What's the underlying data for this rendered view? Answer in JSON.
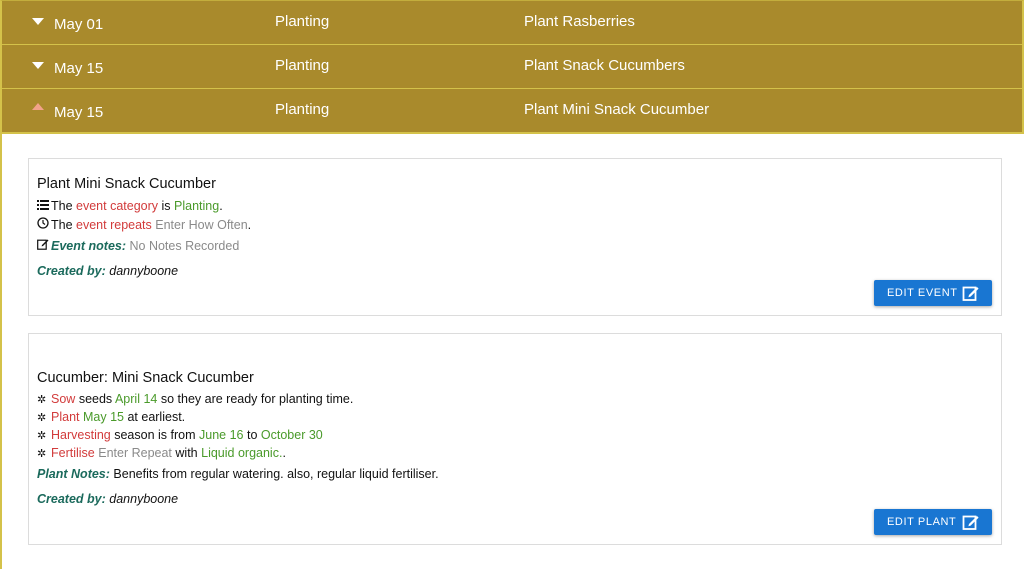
{
  "rows": [
    {
      "date": "May 01",
      "category": "Planting",
      "title": "Plant Rasberries"
    },
    {
      "date": "May 15",
      "category": "Planting",
      "title": "Plant Snack Cucumbers"
    },
    {
      "date": "May 15",
      "category": "Planting",
      "title": "Plant Mini Snack Cucumber"
    }
  ],
  "event_card": {
    "title": "Plant Mini Snack Cucumber",
    "line1": {
      "prefix": "The",
      "key": "event category",
      "mid": "is",
      "value": "Planting",
      "suffix": "."
    },
    "line2": {
      "prefix": "The",
      "key": "event repeats",
      "value": "Enter How Often",
      "suffix": "."
    },
    "notes_label": "Event notes:",
    "notes_value": "No Notes Recorded",
    "created_label": "Created by:",
    "created_value": "dannyboone",
    "button_label": "EDIT EVENT"
  },
  "plant_card": {
    "title": "Cucumber: Mini Snack Cucumber",
    "sow": {
      "key": "Sow",
      "a": "seeds",
      "date": "April 14",
      "b": "so they are ready for planting time."
    },
    "plant": {
      "key": "Plant",
      "date": "May 15",
      "b": "at earliest."
    },
    "harvest": {
      "key": "Harvesting",
      "a": "season is from",
      "from": "June 16",
      "to_word": "to",
      "to": "October 30"
    },
    "fertilise": {
      "key": "Fertilise",
      "repeat": "Enter Repeat",
      "with_word": "with",
      "value": "Liquid organic.",
      "suffix": "."
    },
    "notes_label": "Plant Notes:",
    "notes_value": "Benefits from regular watering. also, regular liquid fertiliser.",
    "created_label": "Created by:",
    "created_value": "dannyboone",
    "button_label": "EDIT PLANT"
  },
  "colors": {
    "header_bg": "#a98a2c",
    "accent_button": "#1976d2",
    "key_red": "#d23b3b",
    "value_green": "#4a9a2a",
    "label_teal": "#1b6a5c"
  }
}
